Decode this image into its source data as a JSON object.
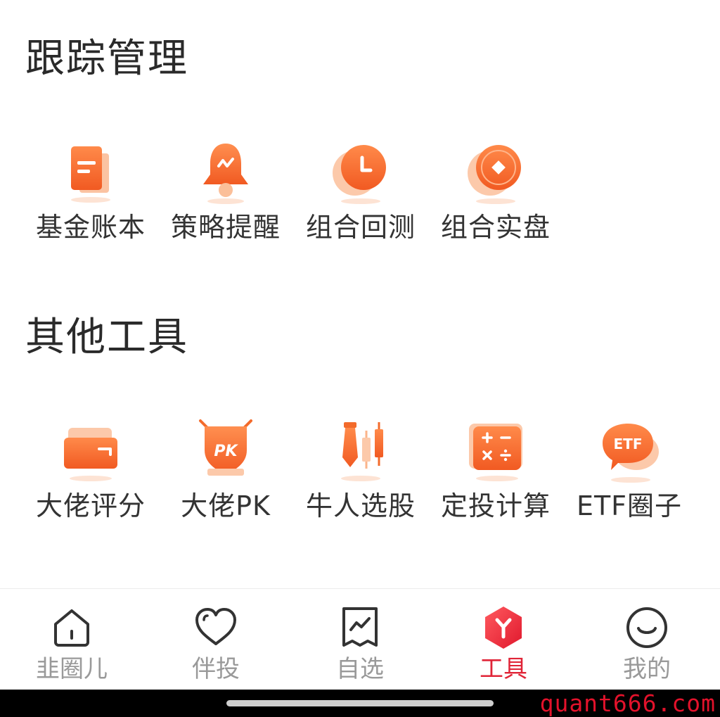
{
  "sections": {
    "tracking": {
      "title": "跟踪管理",
      "items": [
        {
          "label": "基金账本",
          "icon": "fund-ledger-icon"
        },
        {
          "label": "策略提醒",
          "icon": "bell-icon"
        },
        {
          "label": "组合回测",
          "icon": "clock-icon"
        },
        {
          "label": "组合实盘",
          "icon": "coin-icon"
        }
      ]
    },
    "other": {
      "title": "其他工具",
      "items": [
        {
          "label": "大佬评分",
          "icon": "wallet-card-icon"
        },
        {
          "label": "大佬PK",
          "icon": "pk-shield-icon"
        },
        {
          "label": "牛人选股",
          "icon": "tie-candlestick-icon"
        },
        {
          "label": "定投计算",
          "icon": "calculator-icon"
        },
        {
          "label": "ETF圈子",
          "icon": "etf-chat-icon"
        }
      ]
    }
  },
  "nav": {
    "items": [
      {
        "label": "韭圈儿",
        "icon": "home-icon",
        "active": false
      },
      {
        "label": "伴投",
        "icon": "heart-icon",
        "active": false
      },
      {
        "label": "自选",
        "icon": "chart-icon",
        "active": false
      },
      {
        "label": "工具",
        "icon": "tools-hexagon-icon",
        "active": true
      },
      {
        "label": "我的",
        "icon": "smile-icon",
        "active": false
      }
    ]
  },
  "watermark": "quant666.com",
  "colors": {
    "accent_orange": "#f36b2b",
    "light_orange": "#fbb48b",
    "active_red": "#e02437",
    "inactive_gray": "#999999"
  }
}
